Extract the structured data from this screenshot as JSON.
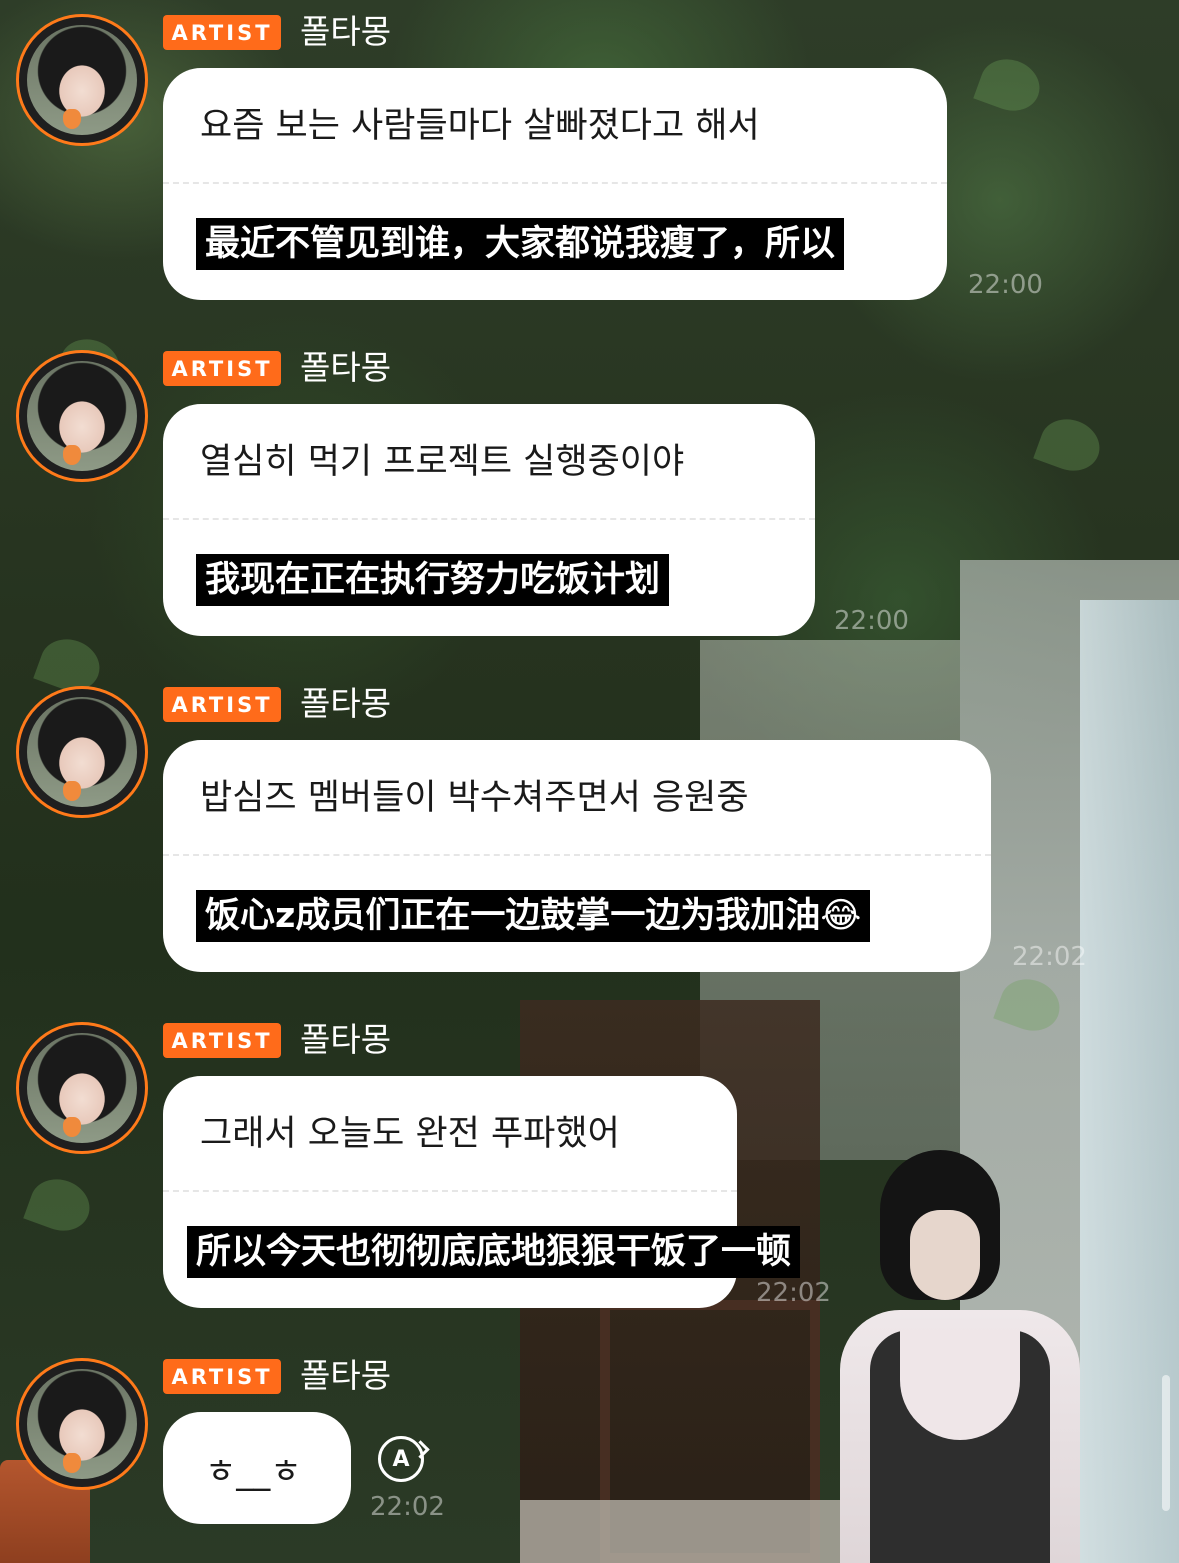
{
  "badge_label": "ARTIST",
  "sender_name": "폴타몽",
  "messages": [
    {
      "ko": "요즘 보는 사람들마다 살빠졌다고 해서",
      "zh": "最近不管见到谁，大家都说我瘦了，所以",
      "time": "22:00"
    },
    {
      "ko": "열심히 먹기 프로젝트 실행중이야",
      "zh": "我现在正在执行努力吃饭计划",
      "time": "22:00"
    },
    {
      "ko": "밥심즈 멤버들이 박수쳐주면서 응원중",
      "zh": "饭心z成员们正在一边鼓掌一边为我加油😂",
      "time": "22:02"
    },
    {
      "ko": "그래서 오늘도 완전 푸파했어",
      "zh": "所以今天也彻彻底底地狠狠干饭了一顿",
      "time": "22:02"
    },
    {
      "text": "ㅎ__ㅎ",
      "time": "22:02"
    }
  ],
  "translate_icon_label": "A",
  "icons": {
    "avatar": "avatar",
    "translate": "translate-icon"
  },
  "colors": {
    "accent": "#ff6b1a",
    "avatar_ring": "#ff7a1a",
    "bubble": "#ffffff",
    "caption_bg": "#000000"
  }
}
